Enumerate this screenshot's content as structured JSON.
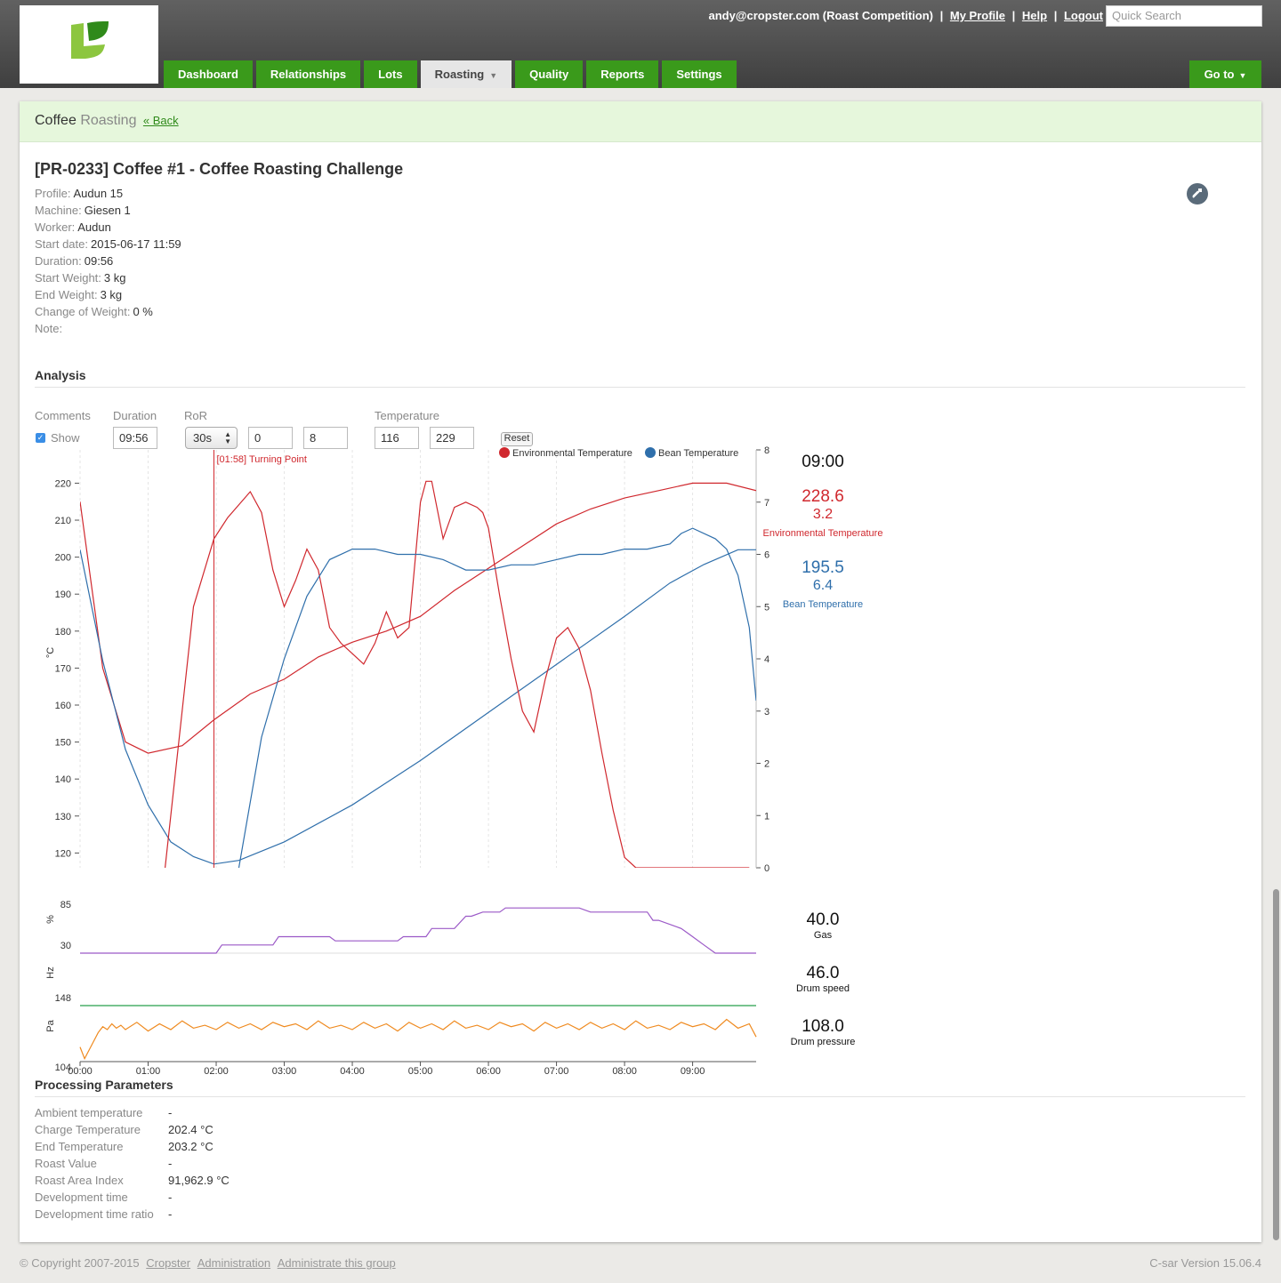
{
  "header": {
    "user": "andy@cropster.com (Roast Competition)",
    "links": [
      "My Profile",
      "Help",
      "Logout"
    ],
    "search_placeholder": "Quick Search",
    "tabs": [
      "Dashboard",
      "Relationships",
      "Lots",
      "Roasting",
      "Quality",
      "Reports",
      "Settings"
    ],
    "active_tab": "Roasting",
    "goto_label": "Go to",
    "brand_color": "#3a9a1b"
  },
  "breadcrumb": {
    "part1": "Coffee",
    "part2": "Roasting",
    "back": "« Back"
  },
  "roast": {
    "title": "[PR-0233] Coffee #1 - Coffee Roasting Challenge",
    "fields": [
      {
        "k": "Profile:",
        "v": "Audun 15"
      },
      {
        "k": "Machine:",
        "v": "Giesen 1"
      },
      {
        "k": "Worker:",
        "v": "Audun"
      },
      {
        "k": "Start date:",
        "v": "2015-06-17 11:59"
      },
      {
        "k": "Duration:",
        "v": "09:56"
      },
      {
        "k": "Start Weight:",
        "v": "3 kg"
      },
      {
        "k": "End Weight:",
        "v": "3 kg"
      },
      {
        "k": "Change of Weight:",
        "v": "0 %"
      },
      {
        "k": "Note:",
        "v": ""
      }
    ]
  },
  "analysis": {
    "heading": "Analysis",
    "labels": {
      "comments": "Comments",
      "duration": "Duration",
      "ror": "RoR",
      "temperature": "Temperature"
    },
    "show_label": "Show",
    "duration_value": "09:56",
    "ror_select": "30s",
    "ror_min": "0",
    "ror_max": "8",
    "temp_min": "116",
    "temp_max": "229",
    "reset_label": "Reset"
  },
  "chart_data": [
    {
      "type": "line",
      "title": "",
      "xlabel": "",
      "ylabel": "°C",
      "y2label": "",
      "xlim": [
        0,
        596
      ],
      "ylim": [
        116,
        229
      ],
      "y2lim": [
        0,
        8
      ],
      "x_ticks": [
        "00:00",
        "01:00",
        "02:00",
        "03:00",
        "04:00",
        "05:00",
        "06:00",
        "07:00",
        "08:00",
        "09:00"
      ],
      "y_ticks": [
        120,
        130,
        140,
        150,
        160,
        170,
        180,
        190,
        200,
        210,
        220
      ],
      "y2_ticks": [
        0,
        1,
        2,
        3,
        4,
        5,
        6,
        7,
        8
      ],
      "legend": [
        "Environmental Temperature",
        "Bean Temperature"
      ],
      "legend_position": "top-right",
      "colors": {
        "env": "#d0282e",
        "bean": "#2f6fab"
      },
      "annotation": {
        "label": "[01:58] Turning Point",
        "x": 118
      },
      "series": [
        {
          "name": "Environmental Temperature",
          "axis": "left",
          "color": "#d0282e",
          "x": [
            0,
            20,
            40,
            60,
            90,
            118,
            150,
            180,
            210,
            240,
            270,
            300,
            330,
            360,
            390,
            420,
            450,
            480,
            510,
            540,
            570,
            596
          ],
          "y": [
            215,
            170,
            150,
            147,
            149,
            156,
            163,
            167,
            173,
            177,
            180,
            184,
            191,
            197,
            203,
            209,
            213,
            216,
            218,
            220,
            220,
            218
          ]
        },
        {
          "name": "Bean Temperature",
          "axis": "left",
          "color": "#2f6fab",
          "x": [
            0,
            20,
            40,
            60,
            80,
            100,
            118,
            140,
            180,
            240,
            300,
            360,
            420,
            480,
            520,
            550,
            580,
            596
          ],
          "y": [
            202,
            172,
            148,
            133,
            123,
            119,
            117,
            118,
            123,
            133,
            145,
            158,
            171,
            184,
            193,
            198,
            202,
            202
          ]
        },
        {
          "name": "Environmental Temperature RoR",
          "axis": "right",
          "color": "#d0282e",
          "x": [
            75,
            100,
            118,
            130,
            150,
            160,
            170,
            180,
            190,
            200,
            210,
            220,
            230,
            240,
            250,
            260,
            270,
            280,
            290,
            300,
            305,
            310,
            320,
            330,
            340,
            350,
            355,
            360,
            370,
            380,
            390,
            400,
            410,
            420,
            430,
            440,
            450,
            460,
            470,
            480,
            490,
            500,
            510,
            520,
            530,
            540,
            550,
            560,
            570,
            580,
            590
          ],
          "y": [
            0,
            5,
            6.3,
            6.7,
            7.2,
            6.8,
            5.7,
            5,
            5.5,
            6.1,
            5.7,
            4.6,
            4.3,
            4.1,
            3.9,
            4.3,
            4.9,
            4.4,
            4.6,
            7.0,
            7.4,
            7.4,
            6.3,
            6.9,
            7.0,
            6.9,
            6.8,
            6.5,
            5.2,
            4.0,
            3.0,
            2.6,
            3.6,
            4.4,
            4.6,
            4.2,
            3.4,
            2.2,
            1.1,
            0.2,
            0,
            0,
            0,
            0,
            0,
            0,
            0,
            0,
            0,
            0,
            0
          ]
        },
        {
          "name": "Bean Temperature RoR",
          "axis": "right",
          "color": "#2f6fab",
          "x": [
            140,
            160,
            180,
            200,
            220,
            240,
            260,
            280,
            300,
            320,
            340,
            360,
            380,
            400,
            420,
            440,
            460,
            480,
            500,
            520,
            530,
            540,
            560,
            570,
            580,
            590,
            596
          ],
          "y": [
            0,
            2.5,
            4.0,
            5.2,
            5.9,
            6.1,
            6.1,
            6.0,
            6.0,
            5.9,
            5.7,
            5.7,
            5.8,
            5.8,
            5.9,
            6.0,
            6.0,
            6.1,
            6.1,
            6.2,
            6.4,
            6.5,
            6.3,
            6.1,
            5.6,
            4.6,
            3.2
          ]
        }
      ]
    },
    {
      "type": "line",
      "title": "",
      "ylabel": "%",
      "y_ticks": [
        30,
        85
      ],
      "series": [
        {
          "name": "Gas",
          "color": "#9b59c7",
          "x": [
            0,
            120,
            125,
            170,
            175,
            220,
            225,
            280,
            285,
            305,
            310,
            330,
            340,
            345,
            355,
            360,
            370,
            375,
            380,
            420,
            440,
            450,
            500,
            505,
            510,
            530,
            535,
            540,
            550,
            560,
            590,
            596
          ],
          "y": [
            30,
            30,
            40,
            40,
            50,
            50,
            45,
            45,
            50,
            50,
            60,
            60,
            75,
            75,
            80,
            80,
            80,
            85,
            85,
            85,
            85,
            80,
            80,
            70,
            70,
            60,
            55,
            50,
            40,
            30,
            30,
            30
          ]
        }
      ]
    },
    {
      "type": "line",
      "title": "",
      "ylabel": "Hz",
      "y_ticks": [],
      "series": [
        {
          "name": "Drum speed",
          "color": "#4caf6a",
          "x": [
            0,
            596
          ],
          "y": [
            46,
            46
          ]
        }
      ]
    },
    {
      "type": "line",
      "title": "",
      "ylabel": "Pa",
      "y_ticks": [
        104,
        148
      ],
      "series": [
        {
          "name": "Drum pressure",
          "color": "#ef8a1f",
          "x": [
            0,
            4,
            8,
            12,
            16,
            20,
            24,
            28,
            32,
            36,
            40,
            50,
            60,
            70,
            80,
            90,
            100,
            110,
            120,
            130,
            140,
            150,
            160,
            170,
            180,
            190,
            200,
            210,
            220,
            230,
            240,
            250,
            260,
            270,
            280,
            290,
            300,
            310,
            320,
            330,
            340,
            350,
            360,
            370,
            380,
            390,
            400,
            410,
            420,
            430,
            440,
            450,
            460,
            470,
            480,
            490,
            500,
            510,
            520,
            530,
            540,
            550,
            560,
            570,
            580,
            590,
            596
          ],
          "y": [
            114,
            106,
            112,
            118,
            124,
            128,
            126,
            130,
            127,
            129,
            126,
            131,
            125,
            130,
            126,
            132,
            127,
            129,
            126,
            131,
            127,
            130,
            126,
            131,
            128,
            130,
            126,
            132,
            127,
            129,
            126,
            131,
            127,
            130,
            125,
            131,
            127,
            130,
            126,
            132,
            127,
            129,
            126,
            131,
            128,
            130,
            125,
            131,
            127,
            130,
            126,
            131,
            127,
            130,
            126,
            132,
            127,
            129,
            126,
            131,
            128,
            130,
            126,
            133,
            127,
            130,
            121
          ]
        }
      ]
    }
  ],
  "axis_ticks": {
    "left": [
      "220",
      "210",
      "200",
      "190",
      "180",
      "170",
      "160",
      "150",
      "140",
      "130",
      "120"
    ],
    "right": [
      "8",
      "7",
      "6",
      "5",
      "4",
      "3",
      "2",
      "1",
      "0"
    ],
    "x": [
      "00:00",
      "01:00",
      "02:00",
      "03:00",
      "04:00",
      "05:00",
      "06:00",
      "07:00",
      "08:00",
      "09:00"
    ],
    "gas": [
      "85",
      "30"
    ],
    "pressure": [
      "148",
      "104"
    ],
    "unit_temp": "°C",
    "unit_gas": "%",
    "unit_speed": "Hz",
    "unit_pressure": "Pa",
    "turning_point": "[01:58] Turning Point",
    "legend_env": "Environmental Temperature",
    "legend_bean": "Bean Temperature"
  },
  "readouts": {
    "time": "09:00",
    "env_value": "228.6",
    "env_ror": "3.2",
    "env_label": "Environmental Temperature",
    "bean_value": "195.5",
    "bean_ror": "6.4",
    "bean_label": "Bean Temperature",
    "gas_value": "40.0",
    "gas_label": "Gas",
    "drum_speed_value": "46.0",
    "drum_speed_label": "Drum speed",
    "drum_pressure_value": "108.0",
    "drum_pressure_label": "Drum pressure"
  },
  "processing": {
    "heading": "Processing Parameters",
    "rows": [
      {
        "k": "Ambient temperature",
        "v": "-"
      },
      {
        "k": "Charge Temperature",
        "v": "202.4 °C"
      },
      {
        "k": "End Temperature",
        "v": "203.2 °C"
      },
      {
        "k": "Roast Value",
        "v": "-"
      },
      {
        "k": "Roast Area Index",
        "v": "91,962.9 °C"
      },
      {
        "k": "Development time",
        "v": "-"
      },
      {
        "k": "Development time ratio",
        "v": "-"
      }
    ]
  },
  "footer": {
    "copyright": "© Copyright 2007-2015",
    "links": [
      "Cropster",
      "Administration",
      "Administrate this group"
    ],
    "version": "C-sar Version 15.06.4"
  }
}
